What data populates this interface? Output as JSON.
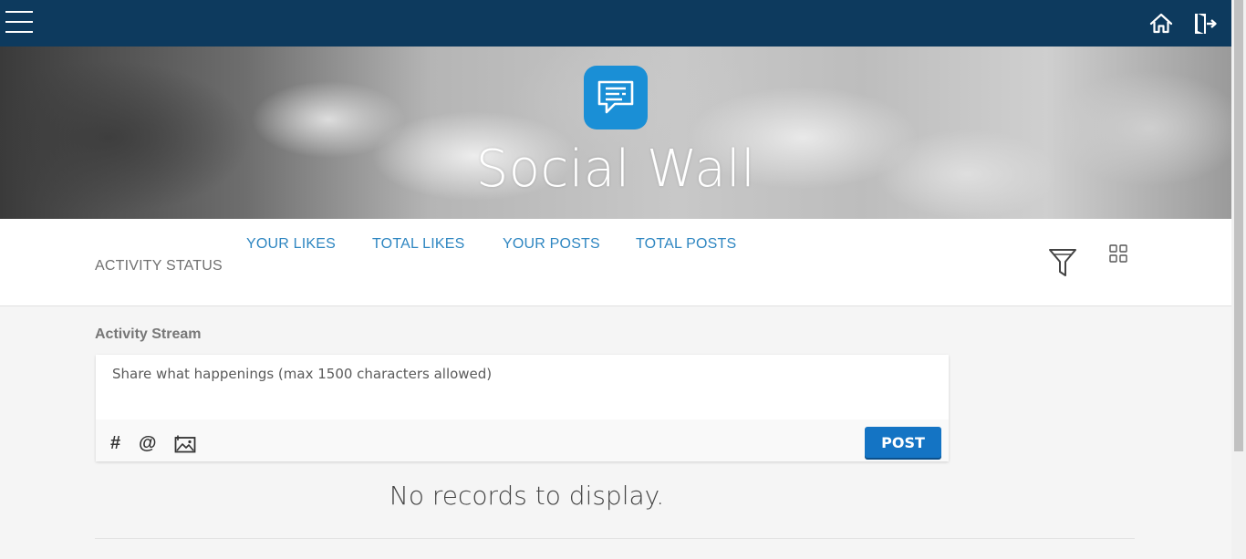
{
  "header": {
    "menu_icon": "hamburger-menu-icon",
    "home_icon": "home-icon",
    "logout_icon": "logout-icon",
    "background_color": "#0d3a5e"
  },
  "banner": {
    "app_icon": "chat-bubble-icon",
    "app_icon_color": "#1a8fd6",
    "title": "Social Wall"
  },
  "activity_status": {
    "label": "ACTIVITY STATUS",
    "tabs": [
      {
        "label": "YOUR LIKES"
      },
      {
        "label": "TOTAL LIKES"
      },
      {
        "label": "YOUR POSTS"
      },
      {
        "label": "TOTAL POSTS"
      }
    ],
    "filter_icon": "filter-icon",
    "grid_icon": "grid-view-icon",
    "accent_color": "#2e86c1"
  },
  "stream": {
    "label": "Activity Stream",
    "composer": {
      "placeholder": "Share what happenings (max 1500 characters allowed)",
      "tools": {
        "hashtag": "#",
        "mention": "@",
        "image_icon": "image-upload-icon"
      },
      "post_label": "POST",
      "post_color": "#1474c4"
    },
    "empty_message": "No records to display."
  }
}
